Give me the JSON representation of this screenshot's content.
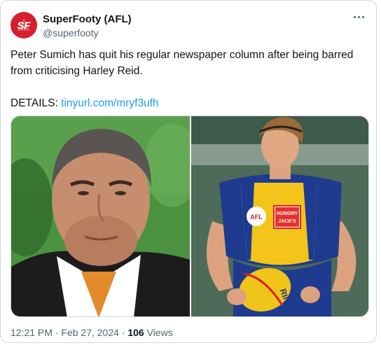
{
  "tweet": {
    "author": {
      "display_name": "SuperFooty (AFL)",
      "handle": "@superfooty",
      "avatar_logo_text": "SF",
      "avatar_color": "#d61f2c"
    },
    "text_line": "Peter Sumich has quit his regular newspaper column after being barred from criticising Harley Reid.",
    "details_label": "DETAILS:",
    "details_link": "tinyurl.com/mryf3ufh",
    "link_color": "#1d9bf0",
    "time": "12:21 PM",
    "separator": "·",
    "date": "Feb 27, 2024",
    "views_count": "106",
    "views_label": "Views",
    "more_icon": "more-horizontal-icon",
    "images": [
      {
        "role": "left-photo"
      },
      {
        "role": "right-photo",
        "ball_text": "RIN",
        "logo_text": "AFL",
        "sponsor_text_1": "HUNGRY",
        "sponsor_text_2": "JACK'S"
      }
    ]
  }
}
